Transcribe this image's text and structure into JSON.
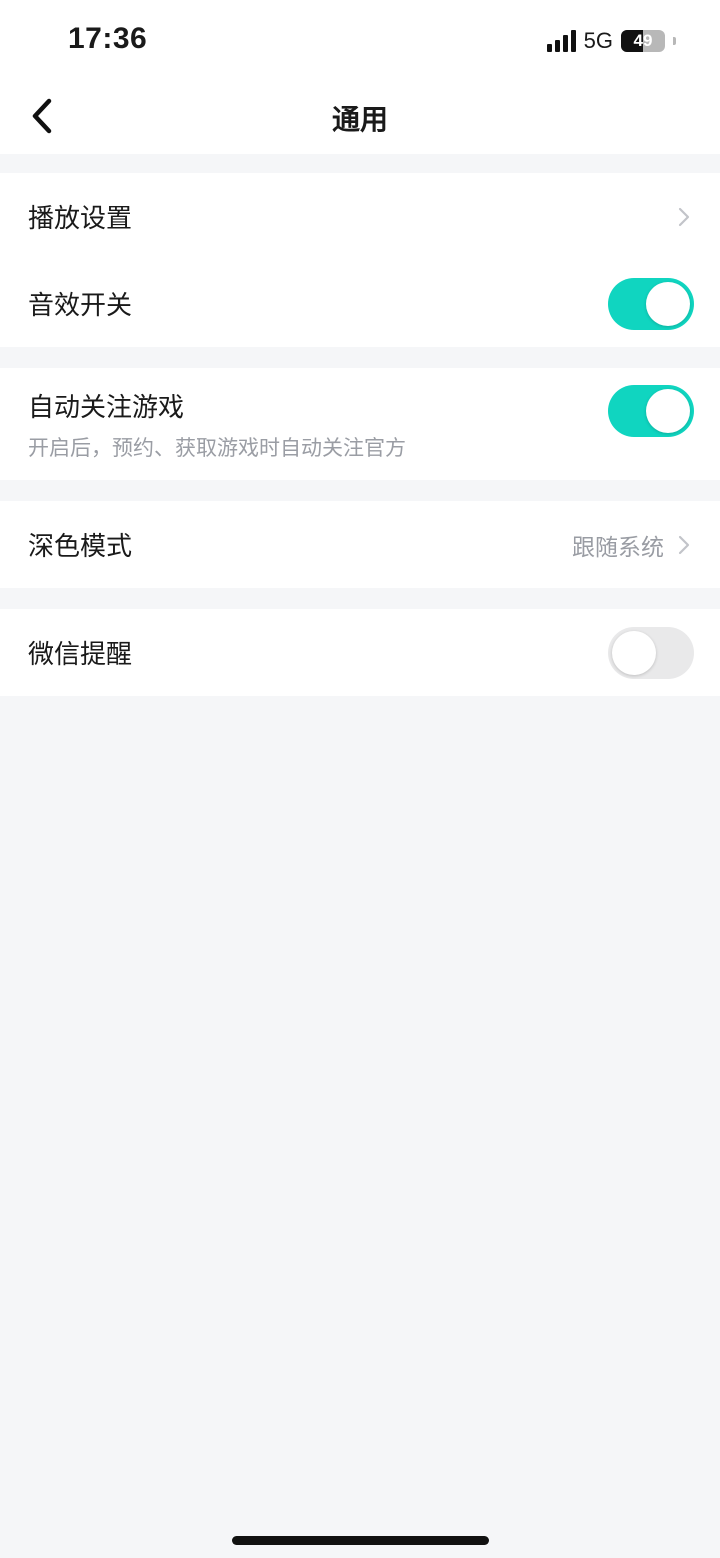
{
  "status_bar": {
    "time": "17:36",
    "network": "5G",
    "battery": "49",
    "battery_level_percent": 49
  },
  "nav": {
    "title": "通用",
    "back_icon": "chevron-left-icon"
  },
  "settings": {
    "playback": {
      "label": "播放设置"
    },
    "sound_effects": {
      "label": "音效开关",
      "enabled": true
    },
    "auto_follow": {
      "label": "自动关注游戏",
      "description": "开启后，预约、获取游戏时自动关注官方",
      "enabled": true
    },
    "dark_mode": {
      "label": "深色模式",
      "value": "跟随系统"
    },
    "wechat_reminder": {
      "label": "微信提醒",
      "enabled": false
    }
  },
  "colors": {
    "accent": "#10d5c0",
    "background": "#f5f6f8",
    "toggle_off": "#e9e9ea"
  }
}
